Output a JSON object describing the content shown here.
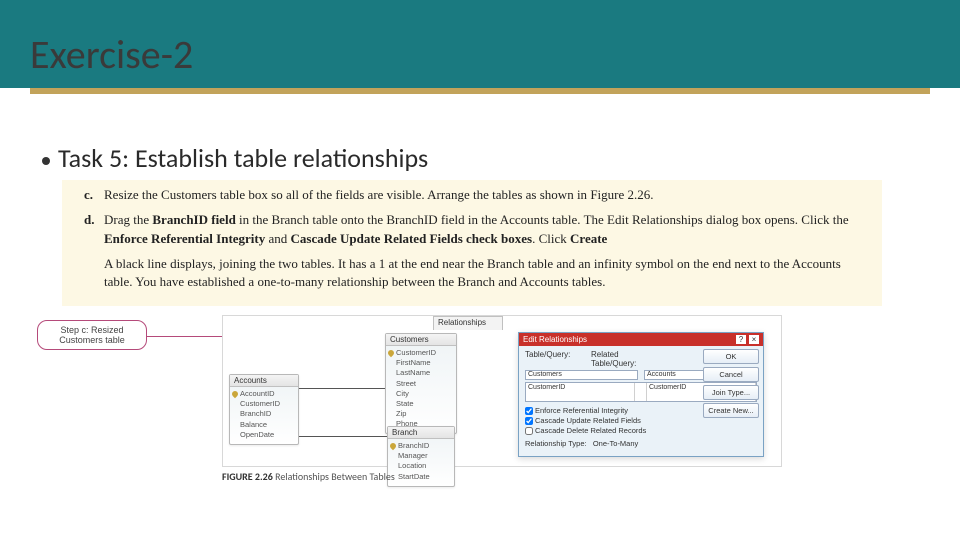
{
  "title": "Exercise-2",
  "bullet": "Task 5: Establish table relationships",
  "steps": {
    "c": {
      "letter": "c.",
      "text_a": "Resize the Customers table box so all of the fields are visible. Arrange the tables as shown in ",
      "fig_ref": "Figure 2.26.",
      "text_b": ""
    },
    "d": {
      "letter": "d.",
      "parts": [
        "Drag the ",
        "BranchID field",
        " in the Branch table onto the BranchID field in the Accounts table. The Edit Relationships dialog box opens. Click the ",
        "Enforce Referential Integrity",
        " and ",
        "Cascade Update Related Fields check boxes",
        ". Click ",
        "Create",
        "."
      ]
    },
    "explain": "A black line displays, joining the two tables. It has a 1 at the end near the Branch table and an infinity symbol on the end next to the Accounts table. You have established a one-to-many relationship between the Branch and Accounts tables."
  },
  "callout": "Step c: Resized Customers table",
  "diagram": {
    "tab": "Relationships",
    "accounts": {
      "title": "Accounts",
      "fields": [
        "AccountID",
        "CustomerID",
        "BranchID",
        "Balance",
        "OpenDate"
      ]
    },
    "customers": {
      "title": "Customers",
      "fields": [
        "CustomerID",
        "FirstName",
        "LastName",
        "Street",
        "City",
        "State",
        "Zip",
        "Phone"
      ]
    },
    "branch": {
      "title": "Branch",
      "fields": [
        "BranchID",
        "Manager",
        "Location",
        "StartDate"
      ]
    }
  },
  "dialog": {
    "title": "Edit Relationships",
    "labels": {
      "tq": "Table/Query:",
      "rtq": "Related Table/Query:"
    },
    "tq_val": "Customers",
    "rtq_val": "Accounts",
    "grid_left": "CustomerID",
    "grid_right": "CustomerID",
    "checks": [
      "Enforce Referential Integrity",
      "Cascade Update Related Fields",
      "Cascade Delete Related Records"
    ],
    "reltype_label": "Relationship Type:",
    "reltype_val": "One-To-Many",
    "buttons": [
      "OK",
      "Cancel",
      "Join Type...",
      "Create New..."
    ]
  },
  "figcap": {
    "num": "FIGURE 2.26",
    "text": " Relationships Between Tables"
  }
}
